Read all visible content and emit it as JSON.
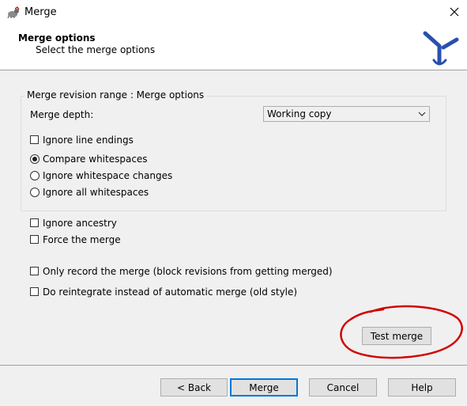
{
  "window": {
    "title": "Merge",
    "close_icon": "close-icon"
  },
  "header": {
    "title": "Merge options",
    "subtitle": "Select the merge options",
    "logo": "tortoisesvn-merge-logo"
  },
  "group": {
    "title": "Merge revision range : Merge options",
    "depth_label": "Merge depth:",
    "depth_value": "Working copy",
    "ignore_line_endings": {
      "label": "Ignore line endings",
      "checked": false
    },
    "whitespace_options": [
      {
        "label": "Compare whitespaces",
        "checked": true
      },
      {
        "label": "Ignore whitespace changes",
        "checked": false
      },
      {
        "label": "Ignore all whitespaces",
        "checked": false
      }
    ]
  },
  "options": {
    "ignore_ancestry": {
      "label": "Ignore ancestry",
      "checked": false
    },
    "force_merge": {
      "label": "Force the merge",
      "checked": false
    },
    "record_only": {
      "label": "Only record the merge (block revisions from getting merged)",
      "checked": false
    },
    "reintegrate": {
      "label": "Do reintegrate instead of automatic merge (old style)",
      "checked": false
    }
  },
  "buttons": {
    "test_merge": "Test merge",
    "back": "< Back",
    "merge": "Merge",
    "cancel": "Cancel",
    "help": "Help"
  },
  "colors": {
    "annotation": "#d10000",
    "default_button_border": "#0078d7",
    "logo": "#2a4fb0"
  }
}
